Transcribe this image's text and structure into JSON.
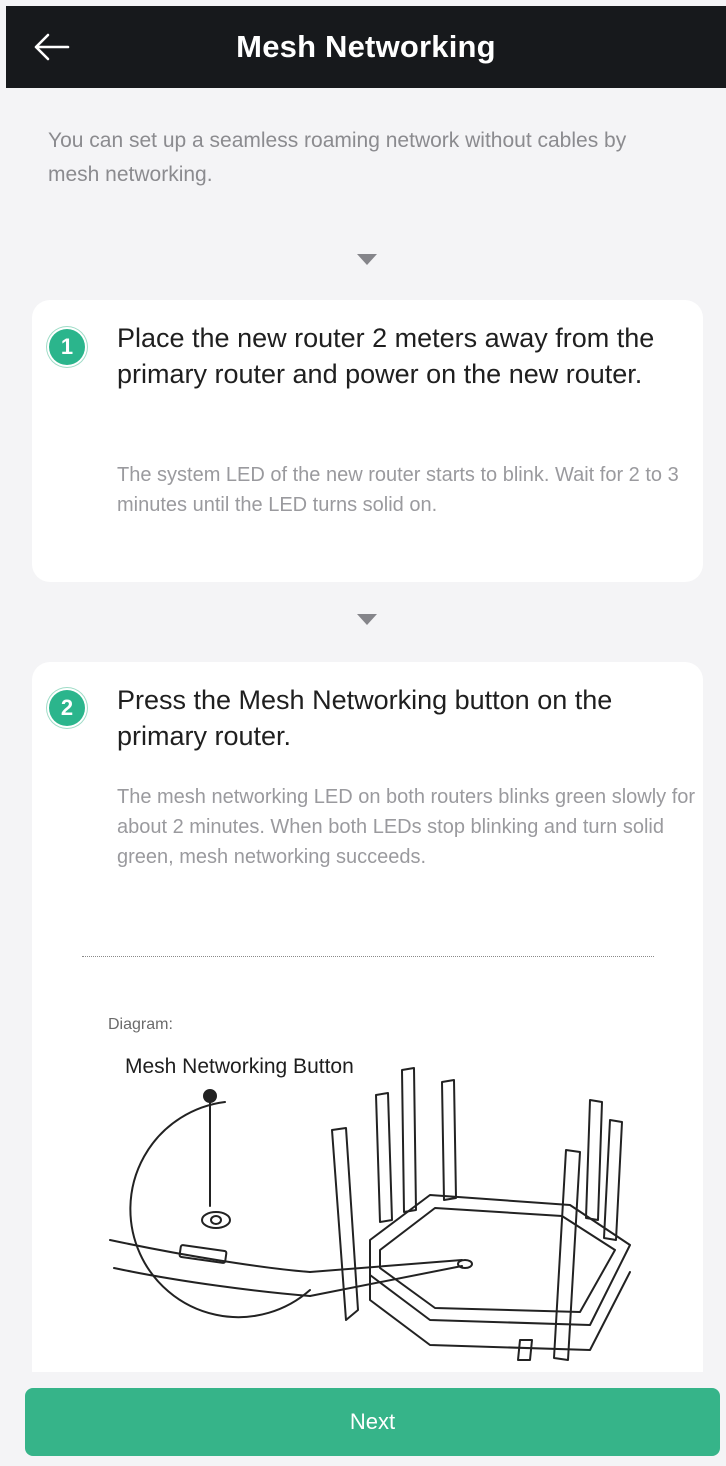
{
  "header": {
    "title": "Mesh Networking",
    "back_icon": "arrow-left-icon"
  },
  "intro": "You can set up a seamless roaming network without cables by mesh networking.",
  "steps": [
    {
      "number": "1",
      "title": "Place the new router 2 meters away from the primary router and power on the new router.",
      "description": "The system LED of the new router starts to blink. Wait for 2 to 3 minutes until the LED turns solid on."
    },
    {
      "number": "2",
      "title": "Press the Mesh Networking button on the primary router.",
      "description": "The mesh networking LED on both routers blinks green slowly for about 2 minutes. When both LEDs stop blinking and turn solid green, mesh networking succeeds."
    }
  ],
  "diagram": {
    "label": "Diagram:",
    "caption": "Mesh Networking Button"
  },
  "footer": {
    "next_label": "Next"
  },
  "colors": {
    "header_bg": "#17191c",
    "accent": "#36b489",
    "badge": "#2bb58c",
    "page_bg": "#f4f4f6"
  }
}
